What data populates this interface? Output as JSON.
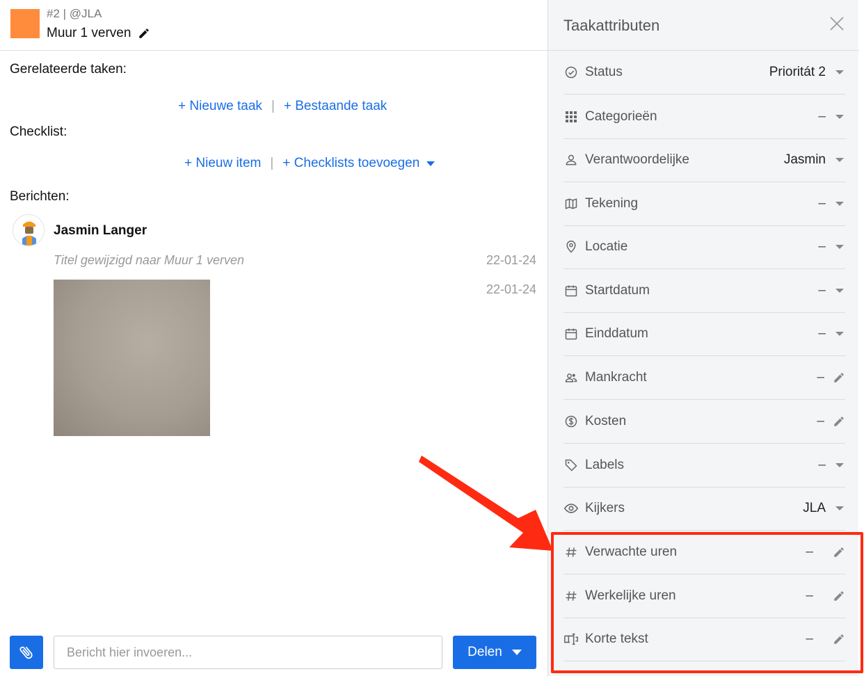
{
  "task": {
    "meta": "#2 | @JLA",
    "title": "Muur 1 verven"
  },
  "related": {
    "label": "Gerelateerde taken:",
    "new_task": "+ Nieuwe taak",
    "separator": "|",
    "existing_task": "+ Bestaande taak"
  },
  "checklist": {
    "label": "Checklist:",
    "new_item": "+ Nieuw item",
    "separator": "|",
    "add_checklists": "+ Checklists toevoegen"
  },
  "messages": {
    "label": "Berichten:",
    "author": "Jasmin Langer",
    "items": [
      {
        "text": "Titel gewijzigd naar Muur 1 verven",
        "date": "22-01-24"
      },
      {
        "text": "",
        "date": "22-01-24"
      }
    ]
  },
  "composer": {
    "placeholder": "Bericht hier invoeren...",
    "share_label": "Delen"
  },
  "panel": {
    "title": "Taakattributen",
    "attributes": [
      {
        "icon": "status-icon",
        "label": "Status",
        "value": "Prioritát 2",
        "control": "dropdown"
      },
      {
        "icon": "grid-icon",
        "label": "Categorieën",
        "value": "–",
        "control": "dropdown"
      },
      {
        "icon": "user-icon",
        "label": "Verantwoordelijke",
        "value": "Jasmin",
        "control": "dropdown"
      },
      {
        "icon": "map-icon",
        "label": "Tekening",
        "value": "–",
        "control": "dropdown"
      },
      {
        "icon": "location-pin-icon",
        "label": "Locatie",
        "value": "–",
        "control": "dropdown"
      },
      {
        "icon": "calendar-icon",
        "label": "Startdatum",
        "value": "–",
        "control": "dropdown"
      },
      {
        "icon": "calendar-icon",
        "label": "Einddatum",
        "value": "–",
        "control": "dropdown"
      },
      {
        "icon": "people-icon",
        "label": "Mankracht",
        "value": "–",
        "control": "edit"
      },
      {
        "icon": "dollar-icon",
        "label": "Kosten",
        "value": "–",
        "control": "edit"
      },
      {
        "icon": "tag-icon",
        "label": "Labels",
        "value": "–",
        "control": "dropdown"
      },
      {
        "icon": "eye-icon",
        "label": "Kijkers",
        "value": "JLA",
        "control": "dropdown"
      },
      {
        "icon": "hash-icon",
        "label": "Verwachte uren",
        "value": "–",
        "control": "edit"
      },
      {
        "icon": "hash-icon",
        "label": "Werkelijke uren",
        "value": "–",
        "control": "edit"
      },
      {
        "icon": "text-field-icon",
        "label": "Korte tekst",
        "value": "–",
        "control": "edit"
      }
    ]
  },
  "colors": {
    "accent": "#1a6ee5",
    "task_color": "#ff8c3c",
    "annotation": "#ff2a12"
  }
}
